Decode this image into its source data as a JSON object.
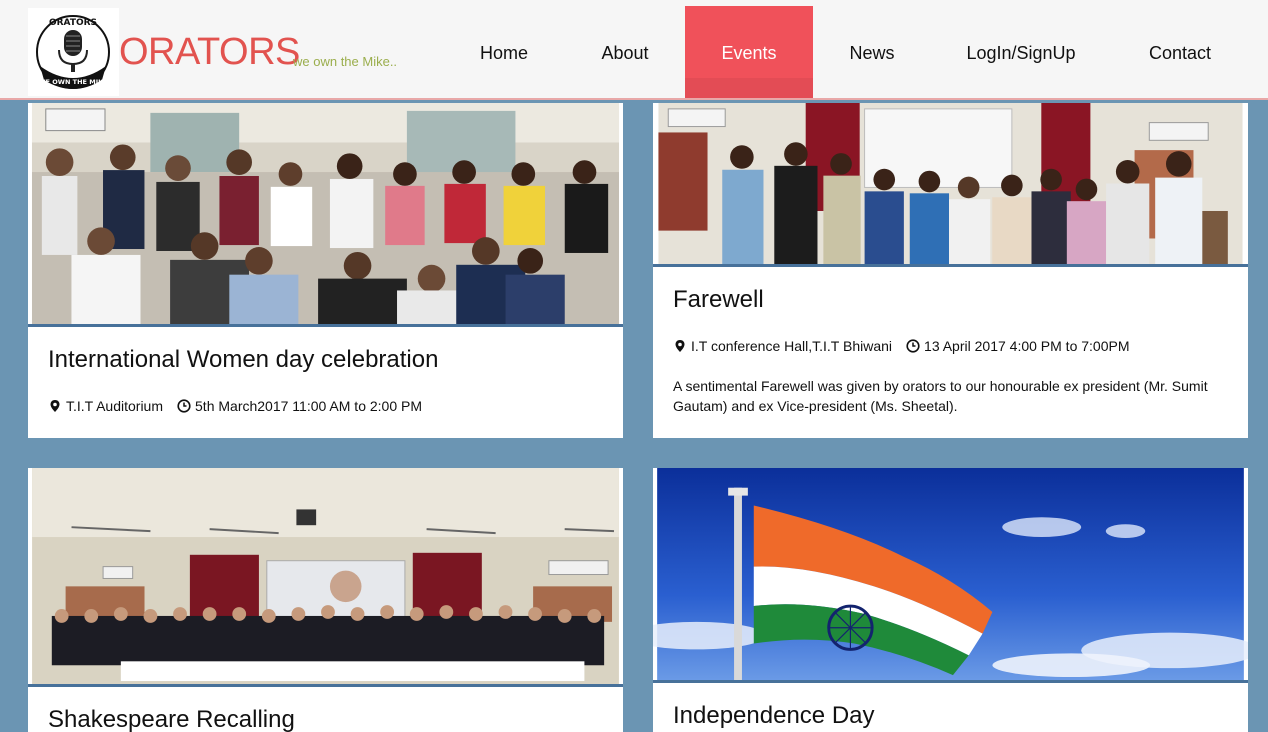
{
  "brand": {
    "name": "ORATORS",
    "tagline": "we own the Mike..",
    "logo_top_text": "ORATORS",
    "logo_bottom_text": "WE OWN THE MIKE"
  },
  "nav": {
    "items": [
      {
        "label": "Home"
      },
      {
        "label": "About"
      },
      {
        "label": "Events",
        "active": true
      },
      {
        "label": "News"
      },
      {
        "label": "LogIn/SignUp"
      },
      {
        "label": "Contact"
      }
    ]
  },
  "events": [
    {
      "title": "International Women day celebration",
      "location": "T.I.T Auditorium",
      "time": "5th March2017 11:00 AM to 2:00 PM",
      "description": "",
      "photo": "group-photo"
    },
    {
      "title": "Farewell",
      "location": "I.T conference Hall,T.I.T Bhiwani",
      "time": "13 April 2017 4:00 PM to 7:00PM",
      "description": "A sentimental Farewell was given by orators to our honourable ex president (Mr. Sumit Gautam) and ex Vice-president (Ms. Sheetal).",
      "photo": "farewell-photo"
    },
    {
      "title": "Shakespeare Recalling",
      "location": "",
      "time": "",
      "description": "",
      "photo": "auditorium-photo"
    },
    {
      "title": "Independence Day",
      "location": "",
      "time": "",
      "description": "",
      "photo": "flag-photo"
    }
  ],
  "icons": {
    "location": "map-marker-icon",
    "time": "clock-icon"
  },
  "colors": {
    "background": "#6b95b3",
    "brand_red": "#e2534f",
    "tagline_green": "#9bae4d",
    "nav_active": "#f0515a",
    "photo_border": "#47719a"
  }
}
